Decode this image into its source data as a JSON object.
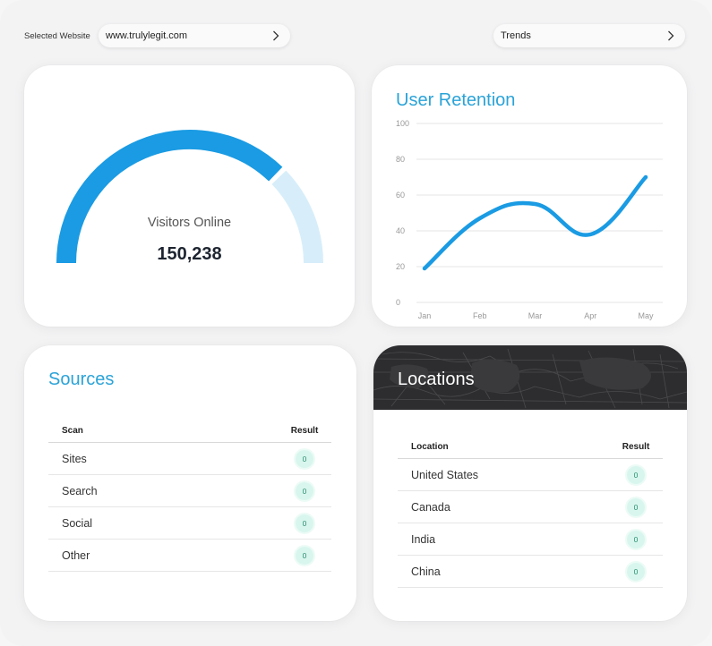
{
  "header": {
    "selected_website_label": "Selected Website",
    "website_value": "www.trulylegit.com",
    "view_select_value": "Trends"
  },
  "visitors": {
    "label": "Visitors Online",
    "value": "150,238",
    "gauge_fraction": 0.75,
    "colors": {
      "fill": "#1a9be3",
      "track": "#d7eefa"
    }
  },
  "retention": {
    "title": "User Retention",
    "chart_data": {
      "type": "line",
      "title": "User Retention",
      "x": [
        "Jan",
        "Feb",
        "Mar",
        "Apr",
        "May"
      ],
      "series": [
        {
          "values": [
            19,
            47,
            55,
            38,
            70
          ]
        }
      ],
      "ylim": [
        0,
        100
      ],
      "yticks": [
        "100",
        "80",
        "60",
        "40",
        "20",
        "0"
      ],
      "grid": true,
      "color": "#1a9be3"
    }
  },
  "sources": {
    "title": "Sources",
    "columns": [
      "Scan",
      "Result"
    ],
    "rows": [
      {
        "name": "Sites",
        "result": "0"
      },
      {
        "name": "Search",
        "result": "0"
      },
      {
        "name": "Social",
        "result": "0"
      },
      {
        "name": "Other",
        "result": "0"
      }
    ]
  },
  "locations": {
    "title": "Locations",
    "columns": [
      "Location",
      "Result"
    ],
    "rows": [
      {
        "name": "United States",
        "result": "0"
      },
      {
        "name": "Canada",
        "result": "0"
      },
      {
        "name": "India",
        "result": "0"
      },
      {
        "name": "China",
        "result": "0"
      }
    ]
  },
  "icons": {
    "site_chevron": "chevron-right-icon",
    "trend_chevron": "chevron-right-icon"
  }
}
